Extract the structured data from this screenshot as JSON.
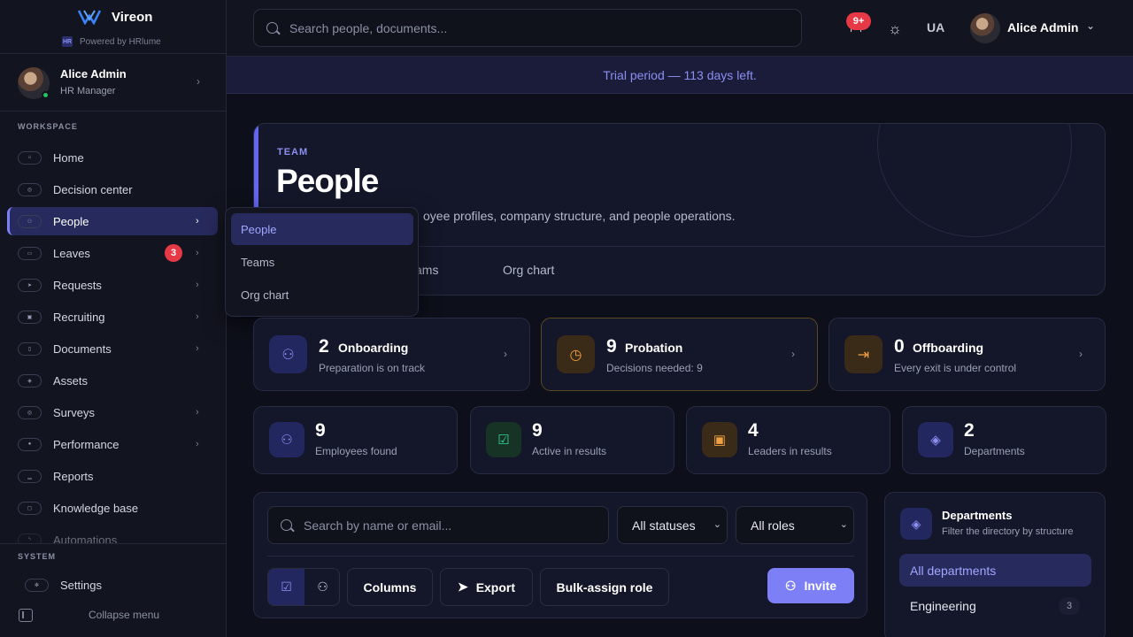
{
  "app": {
    "name": "Vireon",
    "powered_by": "Powered by HRlume",
    "powered_mark": "HR"
  },
  "sidebar": {
    "user": {
      "name": "Alice Admin",
      "role": "HR Manager"
    },
    "workspace_label": "WORKSPACE",
    "items": [
      {
        "label": "Home"
      },
      {
        "label": "Decision center"
      },
      {
        "label": "People"
      },
      {
        "label": "Leaves",
        "badge": "3"
      },
      {
        "label": "Requests"
      },
      {
        "label": "Recruiting"
      },
      {
        "label": "Documents"
      },
      {
        "label": "Assets"
      },
      {
        "label": "Surveys"
      },
      {
        "label": "Performance"
      },
      {
        "label": "Reports"
      },
      {
        "label": "Knowledge base"
      },
      {
        "label": "Automations"
      }
    ],
    "system_label": "SYSTEM",
    "settings_label": "Settings",
    "collapse_label": "Collapse menu"
  },
  "topbar": {
    "search_placeholder": "Search people, documents...",
    "notifications_badge": "9+",
    "language": "UA",
    "user_name": "Alice Admin"
  },
  "trial_banner": "Trial period — 113 days left.",
  "hero": {
    "eyebrow": "TEAM",
    "title": "People",
    "description": "oyee profiles, company structure, and people operations.",
    "tabs": [
      "ams",
      "Org chart"
    ]
  },
  "submenu": {
    "items": [
      "People",
      "Teams",
      "Org chart"
    ]
  },
  "summary_cards": [
    {
      "count": "2",
      "label": "Onboarding",
      "desc": "Preparation is on track"
    },
    {
      "count": "9",
      "label": "Probation",
      "desc": "Decisions needed: 9"
    },
    {
      "count": "0",
      "label": "Offboarding",
      "desc": "Every exit is under control"
    }
  ],
  "stats": [
    {
      "value": "9",
      "label": "Employees found"
    },
    {
      "value": "9",
      "label": "Active in results"
    },
    {
      "value": "4",
      "label": "Leaders in results"
    },
    {
      "value": "2",
      "label": "Departments"
    }
  ],
  "filters": {
    "search_placeholder": "Search by name or email...",
    "status_select": "All statuses",
    "role_select": "All roles",
    "columns_label": "Columns",
    "export_label": "Export",
    "bulk_label": "Bulk-assign role",
    "invite_label": "Invite"
  },
  "departments": {
    "title": "Departments",
    "subtitle": "Filter the directory by structure",
    "all_label": "All departments",
    "rows": [
      {
        "name": "Engineering",
        "count": "3"
      }
    ]
  },
  "colors": {
    "accent": "#7c7ff5",
    "danger": "#e53946",
    "warning": "#e08a2e",
    "success": "#22c55e",
    "background": "#0d0f1a"
  }
}
